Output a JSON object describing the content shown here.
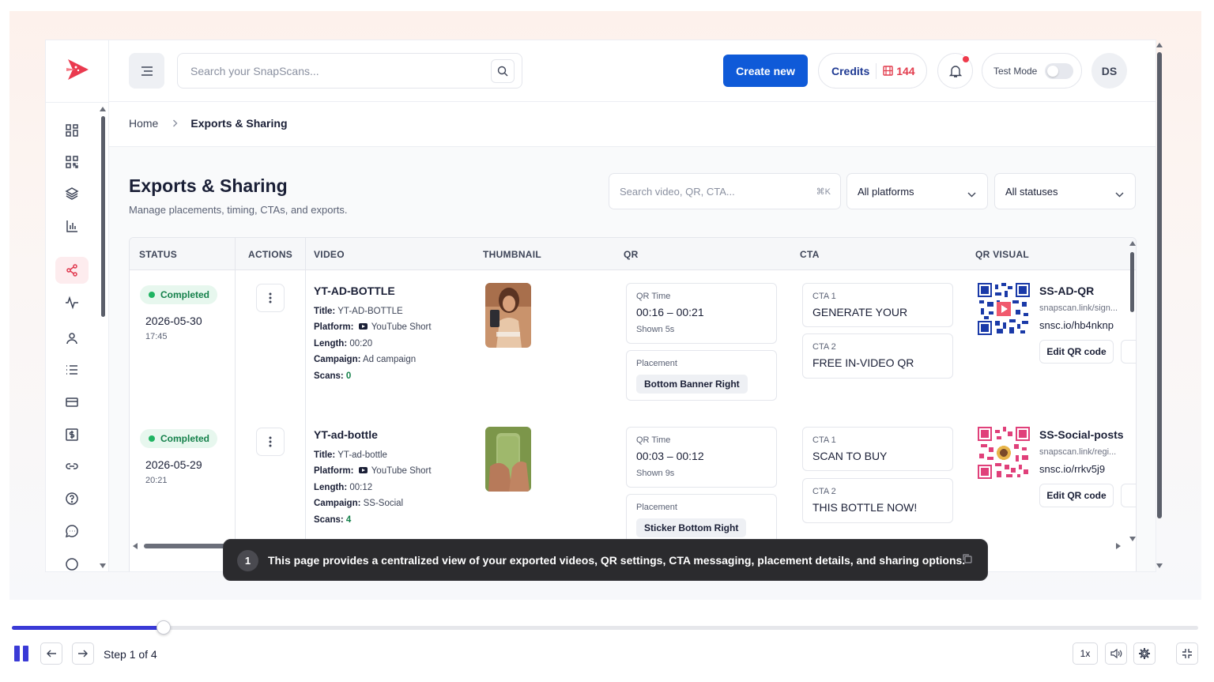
{
  "topbar": {
    "search_placeholder": "Search your SnapScans...",
    "create_label": "Create new",
    "credits_label": "Credits",
    "credits_value": "144",
    "test_mode_label": "Test Mode",
    "avatar_initials": "DS"
  },
  "breadcrumb": {
    "home": "Home",
    "current": "Exports & Sharing"
  },
  "page": {
    "title": "Exports & Sharing",
    "subtitle": "Manage placements, timing, CTAs, and exports.",
    "filter_search_placeholder": "Search video, QR, CTA...",
    "filter_search_kbd": "⌘K",
    "platform_select": "All platforms",
    "status_select": "All statuses"
  },
  "table": {
    "columns": [
      "STATUS",
      "ACTIONS",
      "VIDEO",
      "THUMBNAIL",
      "QR",
      "CTA",
      "QR VISUAL"
    ],
    "labels": {
      "title": "Title:",
      "platform": "Platform:",
      "length": "Length:",
      "campaign": "Campaign:",
      "scans": "Scans:",
      "qr_time": "QR Time",
      "placement": "Placement",
      "edit_qr": "Edit QR code"
    },
    "rows": [
      {
        "status": "Completed",
        "date": "2026-05-30",
        "time": "17:45",
        "video_name": "YT-AD-BOTTLE",
        "title": "YT-AD-BOTTLE",
        "platform": "YouTube Short",
        "length": "00:20",
        "campaign": "Ad campaign",
        "scans": "0",
        "qr_time": "00:16 – 00:21",
        "qr_shown": "Shown 5s",
        "placement": "Bottom Banner Right",
        "cta1_label": "CTA 1",
        "cta1": "GENERATE YOUR",
        "cta2_label": "CTA 2",
        "cta2": "FREE IN-VIDEO QR",
        "qr_name": "SS-AD-QR",
        "qr_link": "snapscan.link/sign...",
        "qr_short": "snsc.io/hb4nknp"
      },
      {
        "status": "Completed",
        "date": "2026-05-29",
        "time": "20:21",
        "video_name": "YT-ad-bottle",
        "title": "YT-ad-bottle",
        "platform": "YouTube Short",
        "length": "00:12",
        "campaign": "SS-Social",
        "scans": "4",
        "qr_time": "00:03 – 00:12",
        "qr_shown": "Shown 9s",
        "placement": "Sticker Bottom Right",
        "cta1_label": "CTA 1",
        "cta1": "SCAN TO BUY",
        "cta2_label": "CTA 2",
        "cta2": "THIS BOTTLE NOW!",
        "qr_name": "SS-Social-posts",
        "qr_link": "snapscan.link/regi...",
        "qr_short": "snsc.io/rrkv5j9"
      }
    ]
  },
  "tooltip": {
    "step_number": "1",
    "text": "This page provides a centralized view of your exported videos, QR settings, CTA messaging, placement details, and sharing options."
  },
  "player": {
    "progress": 0.128,
    "step_text": "Step 1 of 4",
    "speed": "1x"
  },
  "colors": {
    "primary": "#0f5ad8",
    "accent_red": "#e23c4d",
    "success": "#14804a",
    "progress": "#3a3ad6"
  }
}
